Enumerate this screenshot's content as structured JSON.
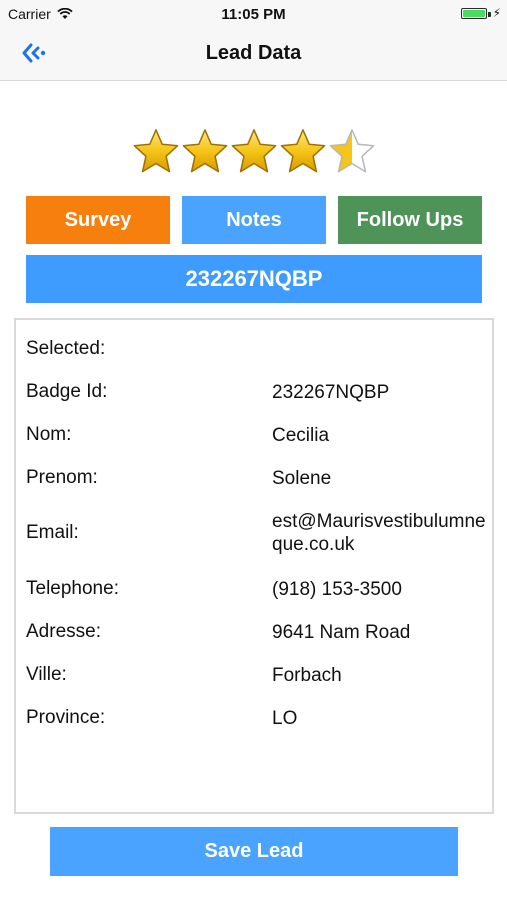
{
  "status_bar": {
    "carrier": "Carrier",
    "time": "11:05 PM"
  },
  "nav": {
    "title": "Lead Data",
    "back_icon": "back-arrow-icon"
  },
  "rating": {
    "value": 4.5,
    "max": 5
  },
  "tabs": {
    "survey": "Survey",
    "notes": "Notes",
    "follow_ups": "Follow Ups"
  },
  "badge_header": "232267NQBP",
  "details": {
    "selected_label": "Selected:",
    "selected_value": "",
    "badge_label": "Badge Id:",
    "badge_value": "232267NQBP",
    "nom_label": "Nom:",
    "nom_value": "Cecilia",
    "prenom_label": "Prenom:",
    "prenom_value": "Solene",
    "email_label": "Email:",
    "email_value": "est@Maurisvestibulumneque.co.uk",
    "telephone_label": "Telephone:",
    "telephone_value": "(918) 153-3500",
    "adresse_label": "Adresse:",
    "adresse_value": "9641 Nam Road",
    "ville_label": "Ville:",
    "ville_value": "Forbach",
    "province_label": "Province:",
    "province_value": "LO"
  },
  "save_button": "Save Lead",
  "colors": {
    "survey": "#f77f0e",
    "notes": "#4aa3ff",
    "follow_ups": "#4e9358",
    "badge_bar": "#3e9bff",
    "save": "#4aa3ff",
    "star": "#f5c518"
  }
}
